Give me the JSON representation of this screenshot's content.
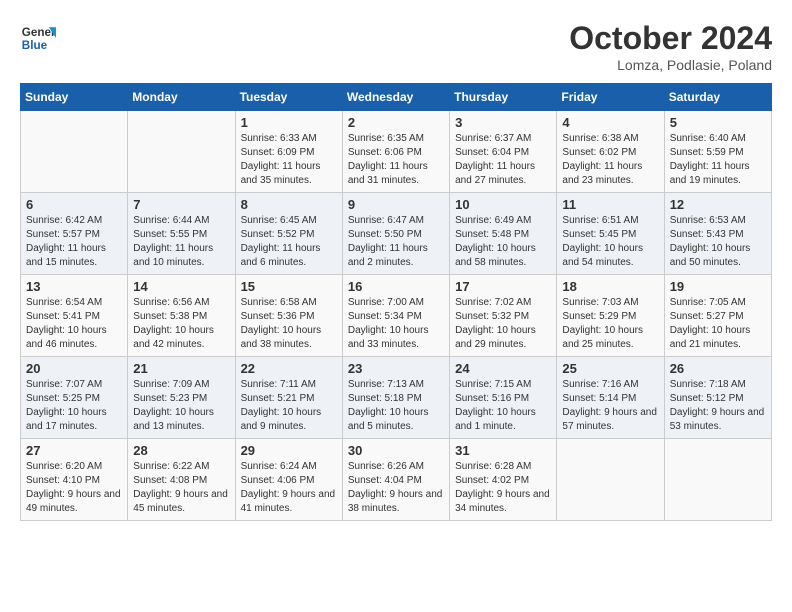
{
  "logo": {
    "line1": "General",
    "line2": "Blue"
  },
  "title": "October 2024",
  "location": "Lomza, Podlasie, Poland",
  "weekdays": [
    "Sunday",
    "Monday",
    "Tuesday",
    "Wednesday",
    "Thursday",
    "Friday",
    "Saturday"
  ],
  "weeks": [
    [
      null,
      null,
      {
        "day": "1",
        "sunrise": "Sunrise: 6:33 AM",
        "sunset": "Sunset: 6:09 PM",
        "daylight": "Daylight: 11 hours and 35 minutes."
      },
      {
        "day": "2",
        "sunrise": "Sunrise: 6:35 AM",
        "sunset": "Sunset: 6:06 PM",
        "daylight": "Daylight: 11 hours and 31 minutes."
      },
      {
        "day": "3",
        "sunrise": "Sunrise: 6:37 AM",
        "sunset": "Sunset: 6:04 PM",
        "daylight": "Daylight: 11 hours and 27 minutes."
      },
      {
        "day": "4",
        "sunrise": "Sunrise: 6:38 AM",
        "sunset": "Sunset: 6:02 PM",
        "daylight": "Daylight: 11 hours and 23 minutes."
      },
      {
        "day": "5",
        "sunrise": "Sunrise: 6:40 AM",
        "sunset": "Sunset: 5:59 PM",
        "daylight": "Daylight: 11 hours and 19 minutes."
      }
    ],
    [
      {
        "day": "6",
        "sunrise": "Sunrise: 6:42 AM",
        "sunset": "Sunset: 5:57 PM",
        "daylight": "Daylight: 11 hours and 15 minutes."
      },
      {
        "day": "7",
        "sunrise": "Sunrise: 6:44 AM",
        "sunset": "Sunset: 5:55 PM",
        "daylight": "Daylight: 11 hours and 10 minutes."
      },
      {
        "day": "8",
        "sunrise": "Sunrise: 6:45 AM",
        "sunset": "Sunset: 5:52 PM",
        "daylight": "Daylight: 11 hours and 6 minutes."
      },
      {
        "day": "9",
        "sunrise": "Sunrise: 6:47 AM",
        "sunset": "Sunset: 5:50 PM",
        "daylight": "Daylight: 11 hours and 2 minutes."
      },
      {
        "day": "10",
        "sunrise": "Sunrise: 6:49 AM",
        "sunset": "Sunset: 5:48 PM",
        "daylight": "Daylight: 10 hours and 58 minutes."
      },
      {
        "day": "11",
        "sunrise": "Sunrise: 6:51 AM",
        "sunset": "Sunset: 5:45 PM",
        "daylight": "Daylight: 10 hours and 54 minutes."
      },
      {
        "day": "12",
        "sunrise": "Sunrise: 6:53 AM",
        "sunset": "Sunset: 5:43 PM",
        "daylight": "Daylight: 10 hours and 50 minutes."
      }
    ],
    [
      {
        "day": "13",
        "sunrise": "Sunrise: 6:54 AM",
        "sunset": "Sunset: 5:41 PM",
        "daylight": "Daylight: 10 hours and 46 minutes."
      },
      {
        "day": "14",
        "sunrise": "Sunrise: 6:56 AM",
        "sunset": "Sunset: 5:38 PM",
        "daylight": "Daylight: 10 hours and 42 minutes."
      },
      {
        "day": "15",
        "sunrise": "Sunrise: 6:58 AM",
        "sunset": "Sunset: 5:36 PM",
        "daylight": "Daylight: 10 hours and 38 minutes."
      },
      {
        "day": "16",
        "sunrise": "Sunrise: 7:00 AM",
        "sunset": "Sunset: 5:34 PM",
        "daylight": "Daylight: 10 hours and 33 minutes."
      },
      {
        "day": "17",
        "sunrise": "Sunrise: 7:02 AM",
        "sunset": "Sunset: 5:32 PM",
        "daylight": "Daylight: 10 hours and 29 minutes."
      },
      {
        "day": "18",
        "sunrise": "Sunrise: 7:03 AM",
        "sunset": "Sunset: 5:29 PM",
        "daylight": "Daylight: 10 hours and 25 minutes."
      },
      {
        "day": "19",
        "sunrise": "Sunrise: 7:05 AM",
        "sunset": "Sunset: 5:27 PM",
        "daylight": "Daylight: 10 hours and 21 minutes."
      }
    ],
    [
      {
        "day": "20",
        "sunrise": "Sunrise: 7:07 AM",
        "sunset": "Sunset: 5:25 PM",
        "daylight": "Daylight: 10 hours and 17 minutes."
      },
      {
        "day": "21",
        "sunrise": "Sunrise: 7:09 AM",
        "sunset": "Sunset: 5:23 PM",
        "daylight": "Daylight: 10 hours and 13 minutes."
      },
      {
        "day": "22",
        "sunrise": "Sunrise: 7:11 AM",
        "sunset": "Sunset: 5:21 PM",
        "daylight": "Daylight: 10 hours and 9 minutes."
      },
      {
        "day": "23",
        "sunrise": "Sunrise: 7:13 AM",
        "sunset": "Sunset: 5:18 PM",
        "daylight": "Daylight: 10 hours and 5 minutes."
      },
      {
        "day": "24",
        "sunrise": "Sunrise: 7:15 AM",
        "sunset": "Sunset: 5:16 PM",
        "daylight": "Daylight: 10 hours and 1 minute."
      },
      {
        "day": "25",
        "sunrise": "Sunrise: 7:16 AM",
        "sunset": "Sunset: 5:14 PM",
        "daylight": "Daylight: 9 hours and 57 minutes."
      },
      {
        "day": "26",
        "sunrise": "Sunrise: 7:18 AM",
        "sunset": "Sunset: 5:12 PM",
        "daylight": "Daylight: 9 hours and 53 minutes."
      }
    ],
    [
      {
        "day": "27",
        "sunrise": "Sunrise: 6:20 AM",
        "sunset": "Sunset: 4:10 PM",
        "daylight": "Daylight: 9 hours and 49 minutes."
      },
      {
        "day": "28",
        "sunrise": "Sunrise: 6:22 AM",
        "sunset": "Sunset: 4:08 PM",
        "daylight": "Daylight: 9 hours and 45 minutes."
      },
      {
        "day": "29",
        "sunrise": "Sunrise: 6:24 AM",
        "sunset": "Sunset: 4:06 PM",
        "daylight": "Daylight: 9 hours and 41 minutes."
      },
      {
        "day": "30",
        "sunrise": "Sunrise: 6:26 AM",
        "sunset": "Sunset: 4:04 PM",
        "daylight": "Daylight: 9 hours and 38 minutes."
      },
      {
        "day": "31",
        "sunrise": "Sunrise: 6:28 AM",
        "sunset": "Sunset: 4:02 PM",
        "daylight": "Daylight: 9 hours and 34 minutes."
      },
      null,
      null
    ]
  ]
}
